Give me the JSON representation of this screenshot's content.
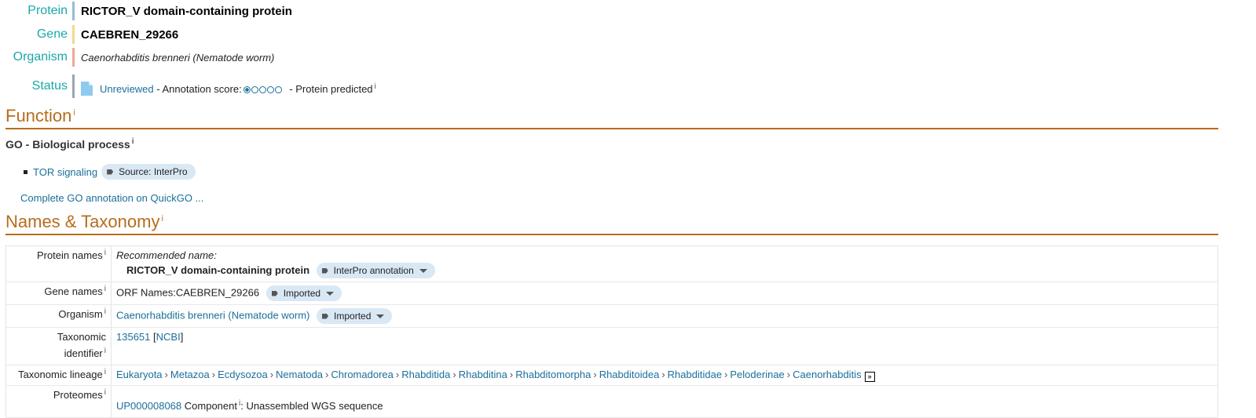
{
  "header": {
    "protein": {
      "label": "Protein",
      "value": "RICTOR_V domain-containing protein",
      "bar_color": "#8fbfd0"
    },
    "gene": {
      "label": "Gene",
      "value": "CAEBREN_29266",
      "bar_color": "#f3d98a"
    },
    "organism": {
      "label": "Organism",
      "value": "Caenorhabditis brenneri (Nematode worm)",
      "bar_color": "#f0a898"
    },
    "status": {
      "label": "Status",
      "bar_color": "#9aa6b0",
      "link": "Unreviewed",
      "annotation_text": "- Annotation score:",
      "score": 1,
      "score_max": 5,
      "predicted_text": "- Protein predicted",
      "info": "i"
    }
  },
  "function": {
    "heading": "Function",
    "info": "i",
    "go_title": "GO - Biological process",
    "go_items": [
      {
        "term": "TOR signaling",
        "source": "Source: InterPro"
      }
    ],
    "quickgo_link": "Complete GO annotation on QuickGO ..."
  },
  "names": {
    "heading": "Names & Taxonomy",
    "info": "i",
    "rows": {
      "protein_names": {
        "label": "Protein names",
        "rec_label": "Recommended name:",
        "rec_value": "RICTOR_V domain-containing protein",
        "tag": "InterPro annotation"
      },
      "gene_names": {
        "label": "Gene names",
        "value": "ORF Names:CAEBREN_29266",
        "tag": "Imported"
      },
      "organism": {
        "label": "Organism",
        "value": "Caenorhabditis brenneri (Nematode worm)",
        "tag": "Imported"
      },
      "tax_id": {
        "label_line1": "Taxonomic",
        "label_line2": "identifier",
        "id": "135651",
        "ncbi": "NCBI",
        "open": "[",
        "close": "]"
      },
      "lineage": {
        "label": "Taxonomic lineage",
        "items": [
          "Eukaryota",
          "Metazoa",
          "Ecdysozoa",
          "Nematoda",
          "Chromadorea",
          "Rhabditida",
          "Rhabditina",
          "Rhabditomorpha",
          "Rhabditoidea",
          "Rhabditidae",
          "Peloderinae",
          "Caenorhabditis"
        ],
        "separator": "›",
        "expand_icon": "»"
      },
      "proteomes": {
        "label": "Proteomes",
        "id": "UP000008068",
        "component": "Component",
        "suffix": ": Unassembled WGS sequence"
      }
    }
  },
  "colors": {
    "accent_teal": "#1ba8a8",
    "section_orange": "#b86c1c",
    "link_blue": "#1a6f9a",
    "tag_bg": "#d9e8f5"
  }
}
